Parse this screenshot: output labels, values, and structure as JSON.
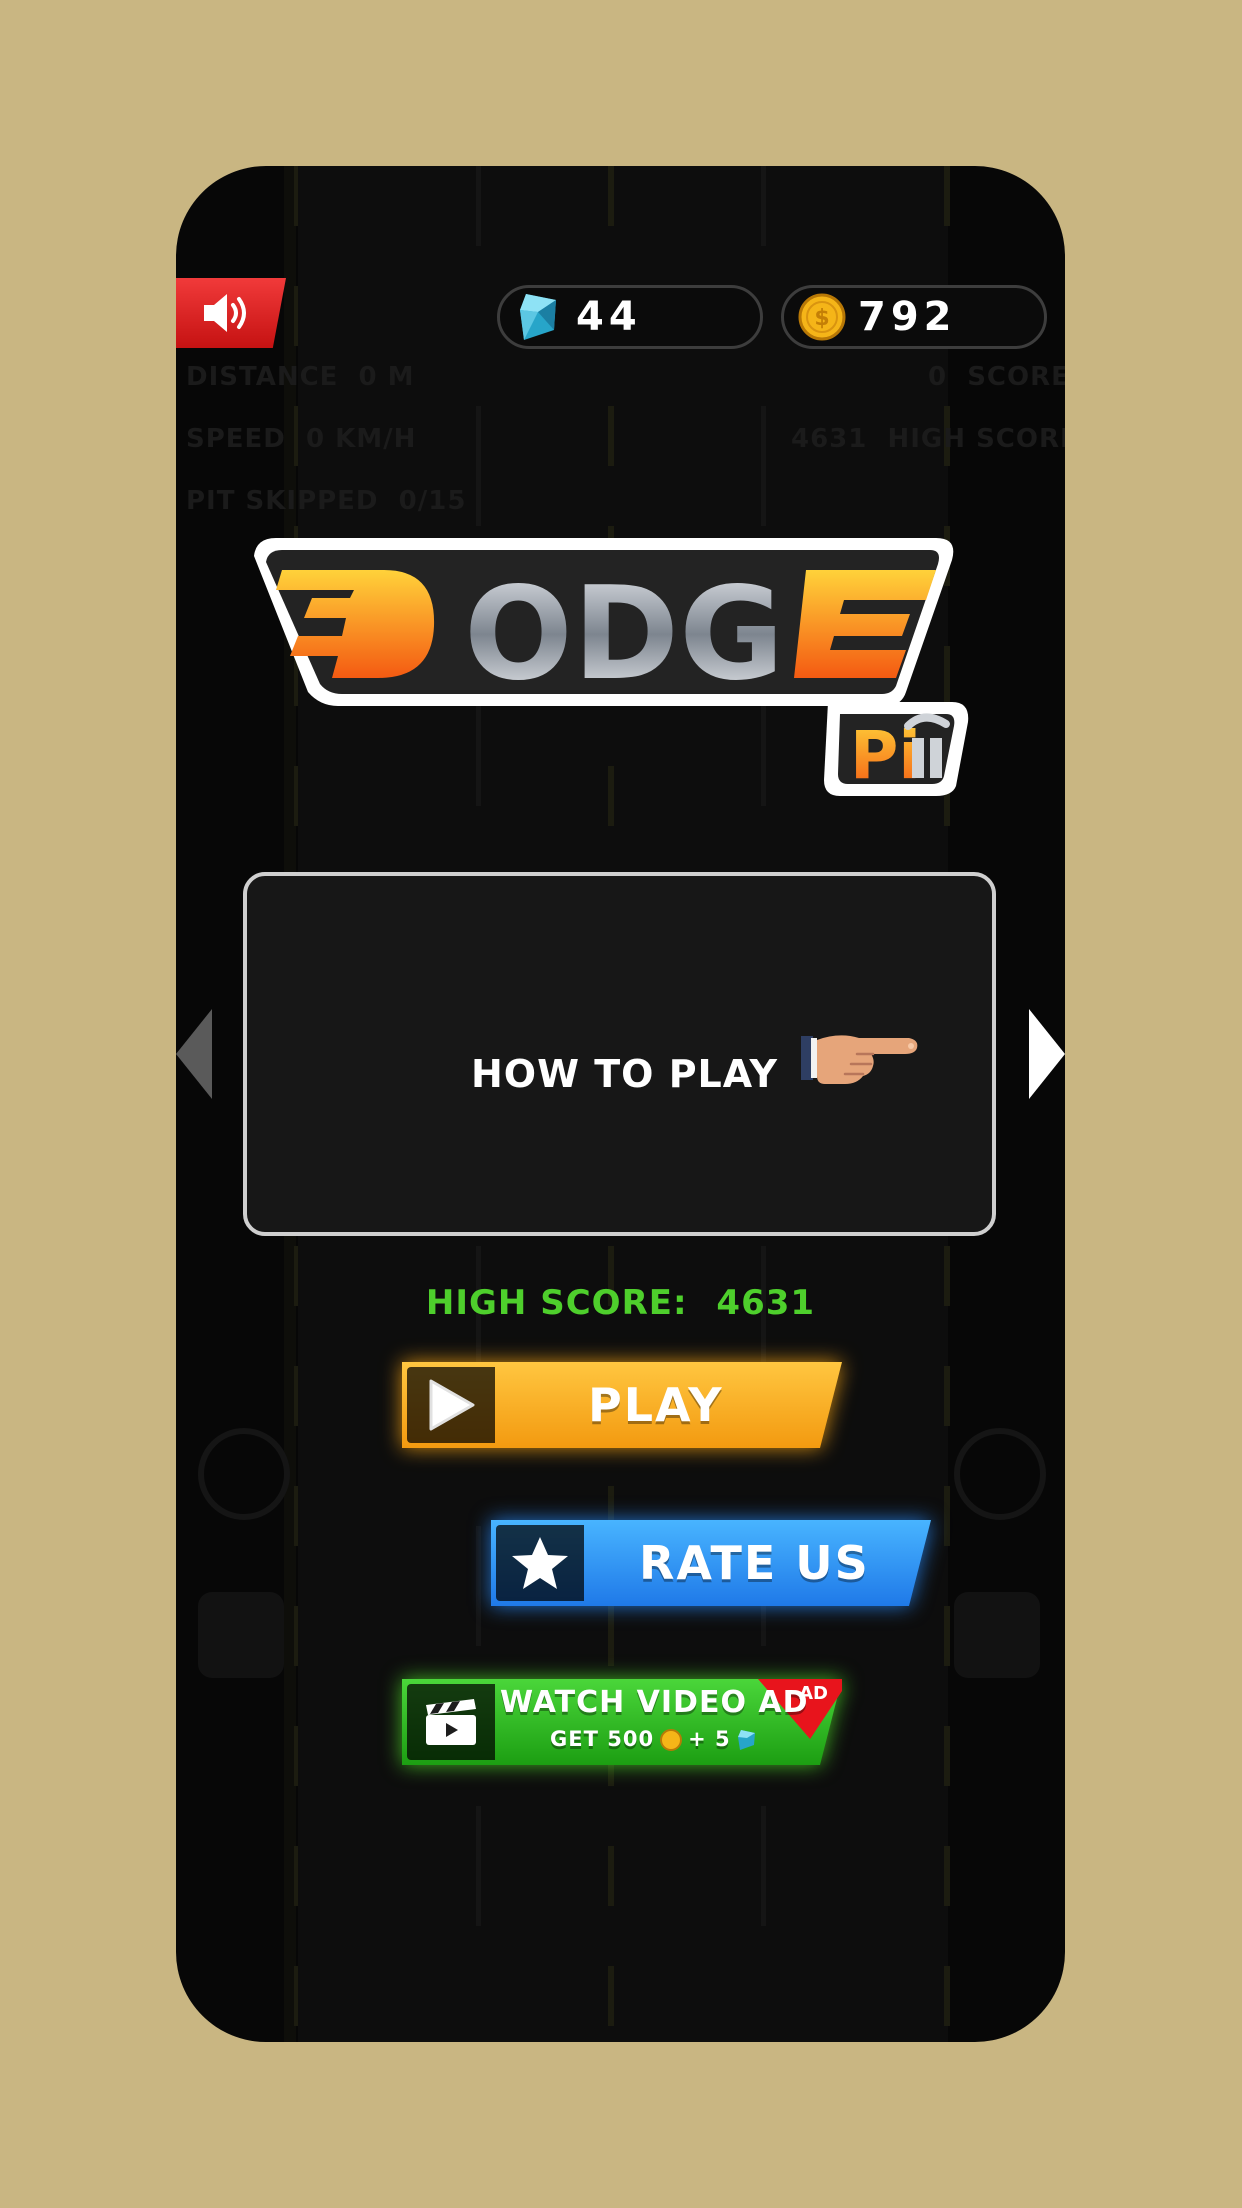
{
  "top_bar": {
    "sound_icon": "speaker-icon",
    "gems": "44",
    "coins": "792"
  },
  "logo": {
    "title": "DODGE",
    "subtitle": "Pit"
  },
  "card": {
    "how_to_play_label": "HOW TO PLAY",
    "hand_icon": "pointing-hand-icon"
  },
  "high_score": {
    "label": "HIGH SCORE:",
    "value": "4631"
  },
  "buttons": {
    "play_label": "PLAY",
    "rate_label": "RATE US",
    "ad_title": "WATCH VIDEO AD",
    "ad_reward_prefix": "GET 500",
    "ad_reward_plus": "+ 5",
    "ad_badge": "AD"
  },
  "background_hud": {
    "distance_label": "DISTANCE",
    "distance_value": "0 M",
    "speed_label": "SPEED",
    "speed_value": "0 KM/H",
    "pit_label": "PIT SKIPPED",
    "pit_value": "0/15",
    "score_value": "0",
    "score_label": "SCORE",
    "highscore_value": "4631",
    "highscore_label": "HIGH SCORE"
  },
  "colors": {
    "background": "#c9b682",
    "play": "#f7a81a",
    "rate": "#2a8cf0",
    "ad": "#2bb01f",
    "high_score_text": "#4ecf2c"
  }
}
